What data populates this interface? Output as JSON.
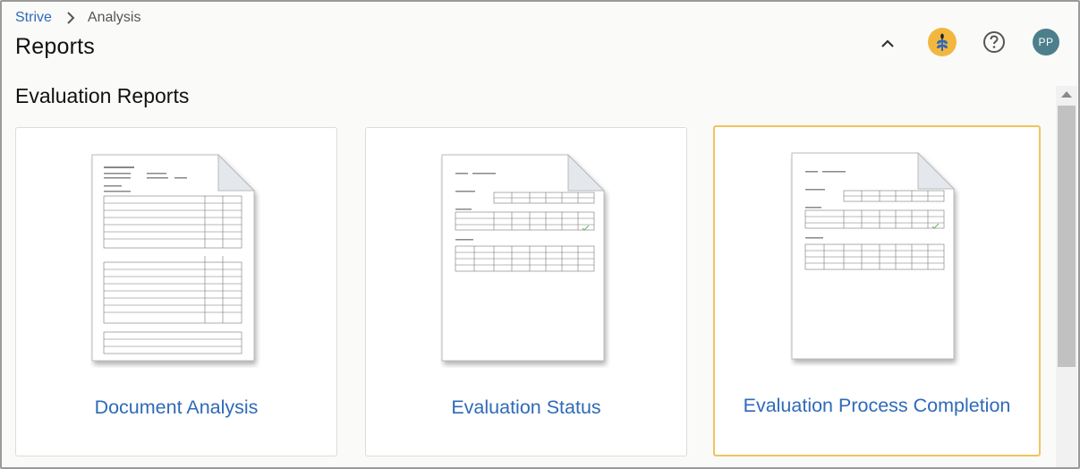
{
  "breadcrumb": {
    "root": "Strive",
    "current": "Analysis"
  },
  "page": {
    "title": "Reports",
    "section_title": "Evaluation Reports"
  },
  "header": {
    "avatar_initials": "PP",
    "icons": [
      "chevron-up-icon",
      "app-logo-icon",
      "help-icon"
    ]
  },
  "colors": {
    "link": "#2f6ab8",
    "selected_border": "#f0c45c",
    "avatar_bg": "#4c7f8c",
    "logo_bg": "#f3b73f",
    "logo_fg": "#2f6ab8"
  },
  "reports": [
    {
      "label": "Document Analysis",
      "selected": false,
      "thumbnail": "document-analysis-preview"
    },
    {
      "label": "Evaluation Status",
      "selected": false,
      "thumbnail": "evaluation-status-preview"
    },
    {
      "label": "Evaluation Process Completion",
      "selected": true,
      "thumbnail": "evaluation-process-completion-preview"
    }
  ]
}
